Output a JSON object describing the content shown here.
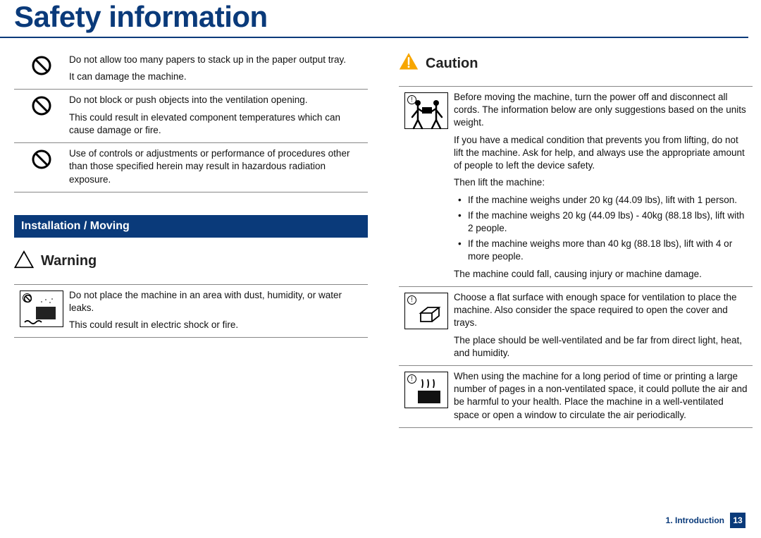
{
  "title": "Safety information",
  "left": {
    "items": [
      {
        "p1": "Do not allow too many papers to stack up in the paper output tray.",
        "p2": "It can damage the machine."
      },
      {
        "p1": "Do not block or push objects into the ventilation opening.",
        "p2": "This could result in elevated component temperatures which can cause damage or fire."
      },
      {
        "p1": "Use of controls or adjustments or performance of procedures other than those specified herein may result in hazardous radiation exposure."
      }
    ],
    "section_heading": "Installation / Moving",
    "warning_label": "Warning",
    "warning_item": {
      "p1": "Do not place the machine in an area with dust, humidity, or water leaks.",
      "p2": "This could result in electric shock or fire."
    }
  },
  "right": {
    "caution_label": "Caution",
    "item1": {
      "p1": "Before moving the machine, turn the power off and disconnect all cords. The information below are only suggestions based on the units weight.",
      "p2": "If you have a medical condition that prevents you from lifting, do not lift the machine. Ask for help, and always use the appropriate amount of people to left the device safety.",
      "p3": "Then lift the machine:",
      "b1": "If the machine weighs under 20 kg (44.09 lbs), lift with 1 person.",
      "b2": "If the machine weighs 20 kg (44.09 lbs) - 40kg (88.18 lbs), lift with 2 people.",
      "b3": "If the machine weighs more than 40 kg (88.18 lbs), lift with 4 or more people.",
      "p4": "The machine could fall, causing injury or machine damage."
    },
    "item2": {
      "p1": "Choose a flat surface with enough space for ventilation to place the machine. Also consider the space required to open the cover and trays.",
      "p2": "The place should be well-ventilated and be far from direct light, heat, and humidity."
    },
    "item3": {
      "p1": "When using the machine for a long period of time or printing a large number of pages in a non-ventilated space, it could pollute the air and be harmful to your health. Place the machine in a well-ventilated space or open a window to circulate the air periodically."
    }
  },
  "footer": {
    "chapter": "1. Introduction",
    "page": "13"
  }
}
